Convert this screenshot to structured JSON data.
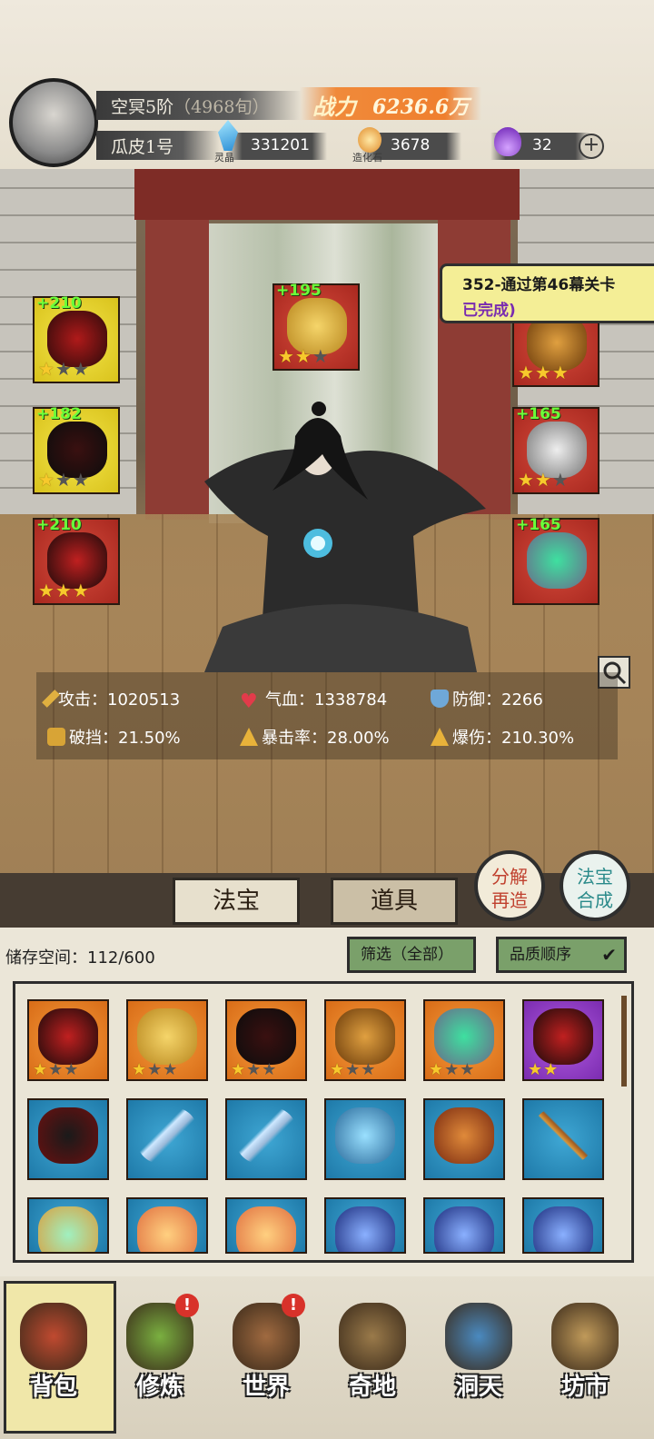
{
  "header": {
    "realm": "空冥5阶",
    "realm_sub": "（4968旬）",
    "player_name": "瓜皮1号",
    "power_label": "战力",
    "power_value": "6236.6万",
    "currencies": [
      {
        "icon": "spirit-crystal-icon",
        "label": "灵晶",
        "value": "331201"
      },
      {
        "icon": "creation-stone-icon",
        "label": "造化石",
        "value": "3678"
      },
      {
        "icon": "purple-flame-icon",
        "label": "",
        "value": "32"
      }
    ],
    "plus_icon": "plus-icon"
  },
  "equipment": {
    "left": [
      {
        "bonus": "+210",
        "stars": 1,
        "frame": "yellow",
        "icon": "dagger-icon"
      },
      {
        "bonus": "+182",
        "stars": 1,
        "frame": "yellow",
        "icon": "robe-icon"
      },
      {
        "bonus": "+210",
        "stars": 3,
        "frame": "red",
        "icon": "boots-icon"
      }
    ],
    "top": {
      "bonus": "+195",
      "stars": 2,
      "frame": "red",
      "icon": "cloud-ornament-icon"
    },
    "right": [
      {
        "bonus": "",
        "stars": 3,
        "frame": "red",
        "icon": "crown-icon"
      },
      {
        "bonus": "+165",
        "stars": 2,
        "frame": "red",
        "icon": "pendant-icon"
      },
      {
        "bonus": "+165",
        "stars": 0,
        "frame": "red",
        "icon": "jade-ring-icon"
      }
    ]
  },
  "quest": {
    "title": "352-通过第46幕关卡",
    "status": "已完成)"
  },
  "stats": [
    {
      "icon": "sword-icon",
      "label": "攻击：",
      "value": "1020513"
    },
    {
      "icon": "heart-icon",
      "label": "气血：",
      "value": "1338784"
    },
    {
      "icon": "shield-icon",
      "label": "防御：",
      "value": "2266"
    },
    {
      "icon": "break-block-icon",
      "label": "破挡：",
      "value": "21.50%"
    },
    {
      "icon": "crit-rate-icon",
      "label": "暴击率：",
      "value": "28.00%"
    },
    {
      "icon": "crit-damage-icon",
      "label": "爆伤：",
      "value": "210.30%"
    }
  ],
  "tabs": [
    {
      "label": "法宝",
      "selected": true
    },
    {
      "label": "道具",
      "selected": false
    }
  ],
  "round_buttons": [
    {
      "label_top": "分解",
      "label_bottom": "再造"
    },
    {
      "label_top": "法宝",
      "label_bottom": "合成"
    }
  ],
  "storage": {
    "label": "储存空间：",
    "value": "112/600",
    "filter_label": "筛选（全部）",
    "sort_label": "品质顺序",
    "sort_icon": "check-arrow-icon",
    "items": [
      {
        "frame": "orange",
        "stars": 1,
        "icon": "boots-icon"
      },
      {
        "frame": "orange",
        "stars": 1,
        "icon": "cloud-ornament-icon"
      },
      {
        "frame": "orange",
        "stars": 0,
        "icon": "robe-icon"
      },
      {
        "frame": "orange",
        "stars": 0,
        "icon": "crown-icon"
      },
      {
        "frame": "orange",
        "stars": 0,
        "icon": "jade-ring-icon"
      },
      {
        "frame": "purple",
        "stars": 2,
        "icon": "boots-icon"
      },
      {
        "frame": "blue",
        "stars": 0,
        "icon": "wheel-icon"
      },
      {
        "frame": "blue",
        "stars": 0,
        "icon": "sword-icon"
      },
      {
        "frame": "blue",
        "stars": 0,
        "icon": "sword-icon"
      },
      {
        "frame": "blue",
        "stars": 0,
        "icon": "bow-icon"
      },
      {
        "frame": "blue",
        "stars": 0,
        "icon": "axe-icon"
      },
      {
        "frame": "blue",
        "stars": 0,
        "icon": "staff-icon"
      },
      {
        "frame": "blue",
        "stars": 0,
        "icon": "mirror-icon"
      },
      {
        "frame": "blue",
        "stars": 0,
        "icon": "lion-mask-icon"
      },
      {
        "frame": "blue",
        "stars": 0,
        "icon": "lion-mask-icon"
      },
      {
        "frame": "blue",
        "stars": 0,
        "icon": "armor-icon"
      },
      {
        "frame": "blue",
        "stars": 0,
        "icon": "armor-icon"
      },
      {
        "frame": "blue",
        "stars": 0,
        "icon": "armor-icon"
      }
    ]
  },
  "nav": [
    {
      "label": "背包",
      "icon": "bag-icon",
      "selected": true,
      "alert": ""
    },
    {
      "label": "修炼",
      "icon": "cultivate-icon",
      "selected": false,
      "alert": "!"
    },
    {
      "label": "世界",
      "icon": "world-scroll-icon",
      "selected": false,
      "alert": "!"
    },
    {
      "label": "奇地",
      "icon": "wonder-land-icon",
      "selected": false,
      "alert": ""
    },
    {
      "label": "洞天",
      "icon": "grotto-icon",
      "selected": false,
      "alert": ""
    },
    {
      "label": "坊市",
      "icon": "market-icon",
      "selected": false,
      "alert": ""
    }
  ]
}
